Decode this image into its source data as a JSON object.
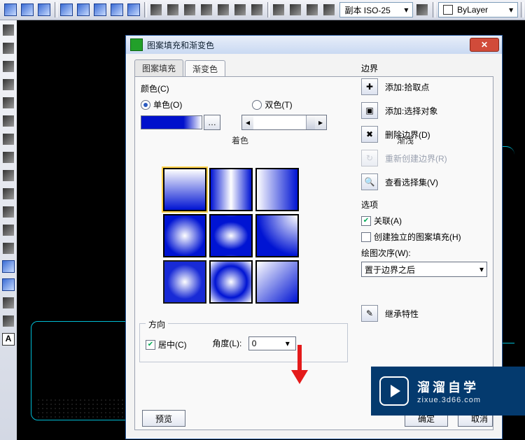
{
  "toolbar": {
    "dimstyle": "副本 ISO-25",
    "layer": "ByLayer"
  },
  "dialog": {
    "title": "图案填充和渐变色",
    "tabs": {
      "pattern": "图案填充",
      "gradient": "渐变色"
    },
    "color_label": "颜色(C)",
    "mono": "单色(O)",
    "duo": "双色(T)",
    "tint": "着色",
    "fade": "渐浅",
    "direction": {
      "legend": "方向",
      "centered": "居中(C)",
      "angle_label": "角度(L):",
      "angle_value": "0"
    },
    "buttons": {
      "preview": "预览",
      "ok": "确定",
      "cancel_partial": "取消"
    }
  },
  "right": {
    "boundary_title": "边界",
    "pick": "添加:拾取点",
    "select": "添加:选择对象",
    "remove": "删除边界(D)",
    "recreate": "重新创建边界(R)",
    "viewsel": "查看选择集(V)",
    "options_title": "选项",
    "assoc": "关联(A)",
    "indep": "创建独立的图案填充(H)",
    "order_label": "绘图次序(W):",
    "order_value": "置于边界之后",
    "inherit": "继承特性"
  },
  "watermark": {
    "ch": "溜溜自学",
    "en": "zixue.3d66.com"
  }
}
